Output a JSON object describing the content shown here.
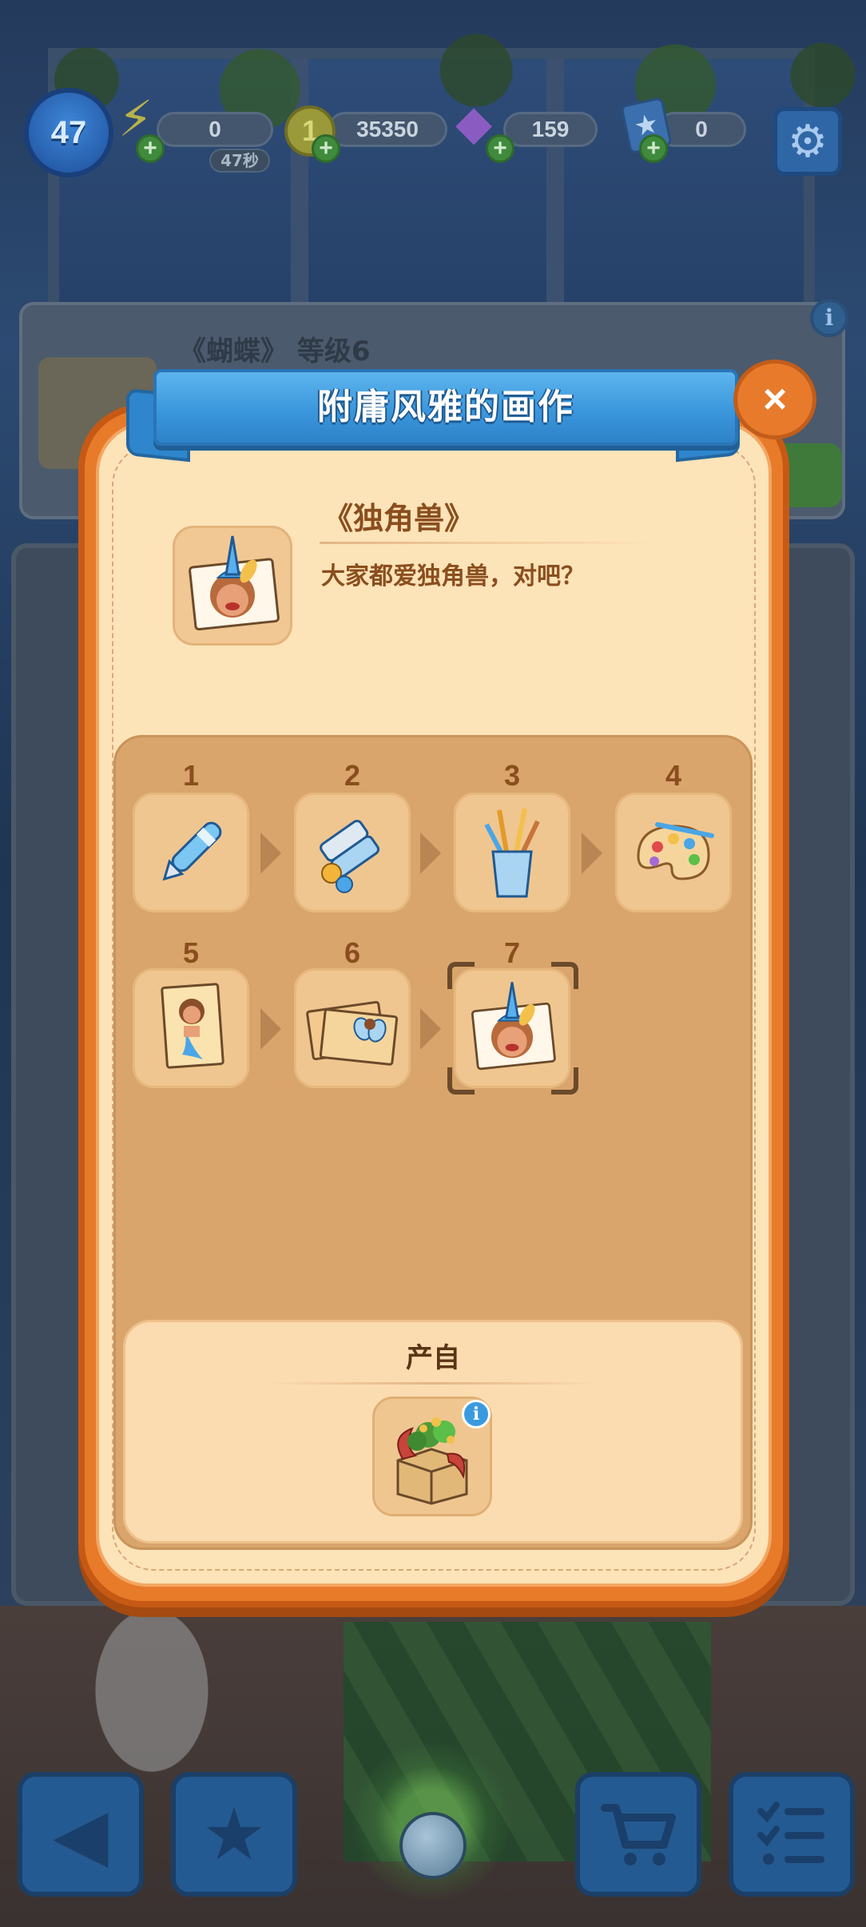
{
  "hud": {
    "level": "47",
    "energy": "0",
    "energy_timer": "47秒",
    "coins": "35350",
    "gems": "159",
    "stars": "0"
  },
  "background": {
    "panel_title": "《蝴蝶》 等级6"
  },
  "modal": {
    "title": "附庸风雅的画作",
    "close_label": "×",
    "item": {
      "name": "《独角兽》",
      "description": "大家都爱独角兽，对吧？"
    },
    "chain": [
      {
        "num": "1",
        "icon": "pen-icon"
      },
      {
        "num": "2",
        "icon": "paint-tubes-icon"
      },
      {
        "num": "3",
        "icon": "brush-cup-icon"
      },
      {
        "num": "4",
        "icon": "palette-icon"
      },
      {
        "num": "5",
        "icon": "mermaid-portrait-icon"
      },
      {
        "num": "6",
        "icon": "butterfly-postcards-icon"
      },
      {
        "num": "7",
        "icon": "unicorn-portrait-icon",
        "selected": true
      }
    ],
    "source": {
      "title": "产自",
      "icon": "gift-box-icon",
      "info": "i"
    }
  },
  "colors": {
    "modal_orange": "#e77b2a",
    "ribbon_blue": "#3b97dc",
    "panel_cream": "#fde3b8",
    "chain_tan": "#d9a56c",
    "text_brown": "#8a4e1e"
  }
}
